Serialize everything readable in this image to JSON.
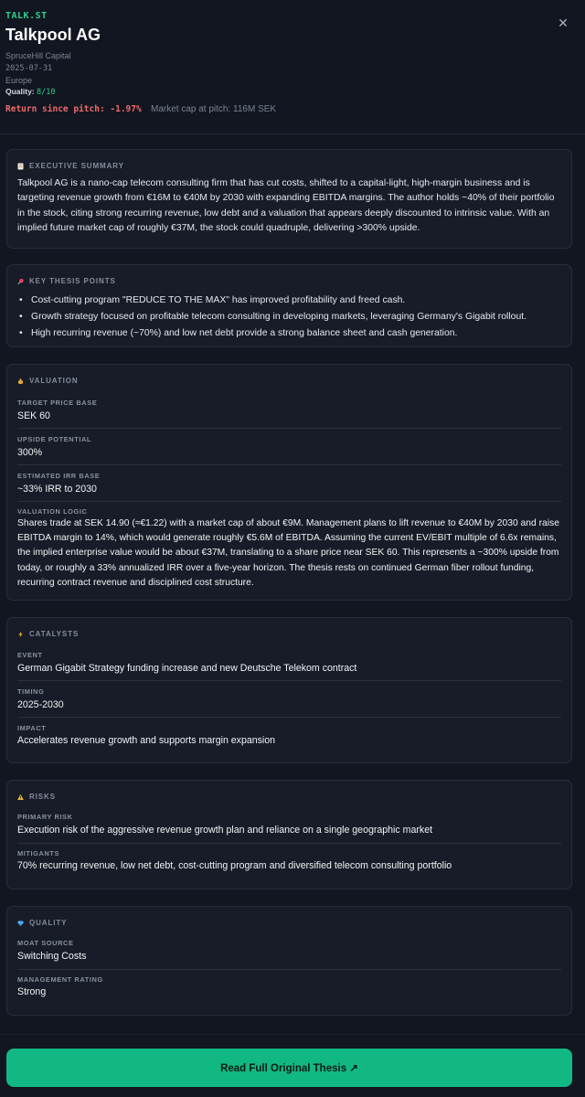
{
  "header": {
    "ticker": "TALK.ST",
    "company": "Talkpool AG",
    "source": "SpruceHill Capital",
    "date": "2025-07-31",
    "region": "Europe",
    "quality_label": "Quality:",
    "quality_value": "8/10",
    "return_text": "Return since pitch: -1.97%",
    "market_cap_text": "Market cap at pitch: 116M SEK",
    "close_icon": "close-icon",
    "colors": {
      "accent": "#2fcf8c",
      "negative": "#ef6a6a"
    }
  },
  "summary": {
    "title": "Executive Summary",
    "icon": "document-icon",
    "text": "Talkpool AG is a nano-cap telecom consulting firm that has cut costs, shifted to a capital-light, high-margin business and is targeting revenue growth from €16M to €40M by 2030 with expanding EBITDA margins. The author holds ~40% of their portfolio in the stock, citing strong recurring revenue, low debt and a valuation that appears deeply discounted to intrinsic value. With an implied future market cap of roughly €37M, the stock could quadruple, delivering >300% upside."
  },
  "thesis": {
    "title": "Key Thesis Points",
    "icon": "pushpin-icon",
    "points": [
      "Cost-cutting program \"REDUCE TO THE MAX\" has improved profitability and freed cash.",
      "Growth strategy focused on profitable telecom consulting in developing markets, leveraging Germany's Gigabit rollout.",
      "High recurring revenue (~70%) and low net debt provide a strong balance sheet and cash generation."
    ]
  },
  "valuation": {
    "title": "Valuation",
    "icon": "money-bag-icon",
    "target_label": "Target Price Base",
    "target_value": "SEK 60",
    "upside_label": "Upside Potential",
    "upside_value": "300%",
    "irr_label": "Estimated IRR Base",
    "irr_value": "~33% IRR to 2030",
    "logic_label": "Valuation Logic",
    "logic_value": "Shares trade at SEK 14.90 (≈€1.22) with a market cap of about €9M. Management plans to lift revenue to €40M by 2030 and raise EBITDA margin to 14%, which would generate roughly €5.6M of EBITDA. Assuming the current EV/EBIT multiple of 6.6x remains, the implied enterprise value would be about €37M, translating to a share price near SEK 60. This represents a ~300% upside from today, or roughly a 33% annualized IRR over a five-year horizon. The thesis rests on continued German fiber rollout funding, recurring contract revenue and disciplined cost structure."
  },
  "catalysts": {
    "title": "Catalysts",
    "icon": "lightning-icon",
    "event_label": "Event",
    "event_value": "German Gigabit Strategy funding increase and new Deutsche Telekom contract",
    "timing_label": "Timing",
    "timing_value": "2025-2030",
    "impact_label": "Impact",
    "impact_value": "Accelerates revenue growth and supports margin expansion"
  },
  "risks": {
    "title": "Risks",
    "icon": "warning-icon",
    "primary_label": "Primary Risk",
    "primary_value": "Execution risk of the aggressive revenue growth plan and reliance on a single geographic market",
    "mitigants_label": "Mitigants",
    "mitigants_value": "70% recurring revenue, low net debt, cost-cutting program and diversified telecom consulting portfolio"
  },
  "quality": {
    "title": "Quality",
    "icon": "gem-icon",
    "moat_label": "Moat Source",
    "moat_value": "Switching Costs",
    "mgmt_label": "Management Rating",
    "mgmt_value": "Strong"
  },
  "cta": {
    "label": "Read Full Original Thesis ↗"
  }
}
